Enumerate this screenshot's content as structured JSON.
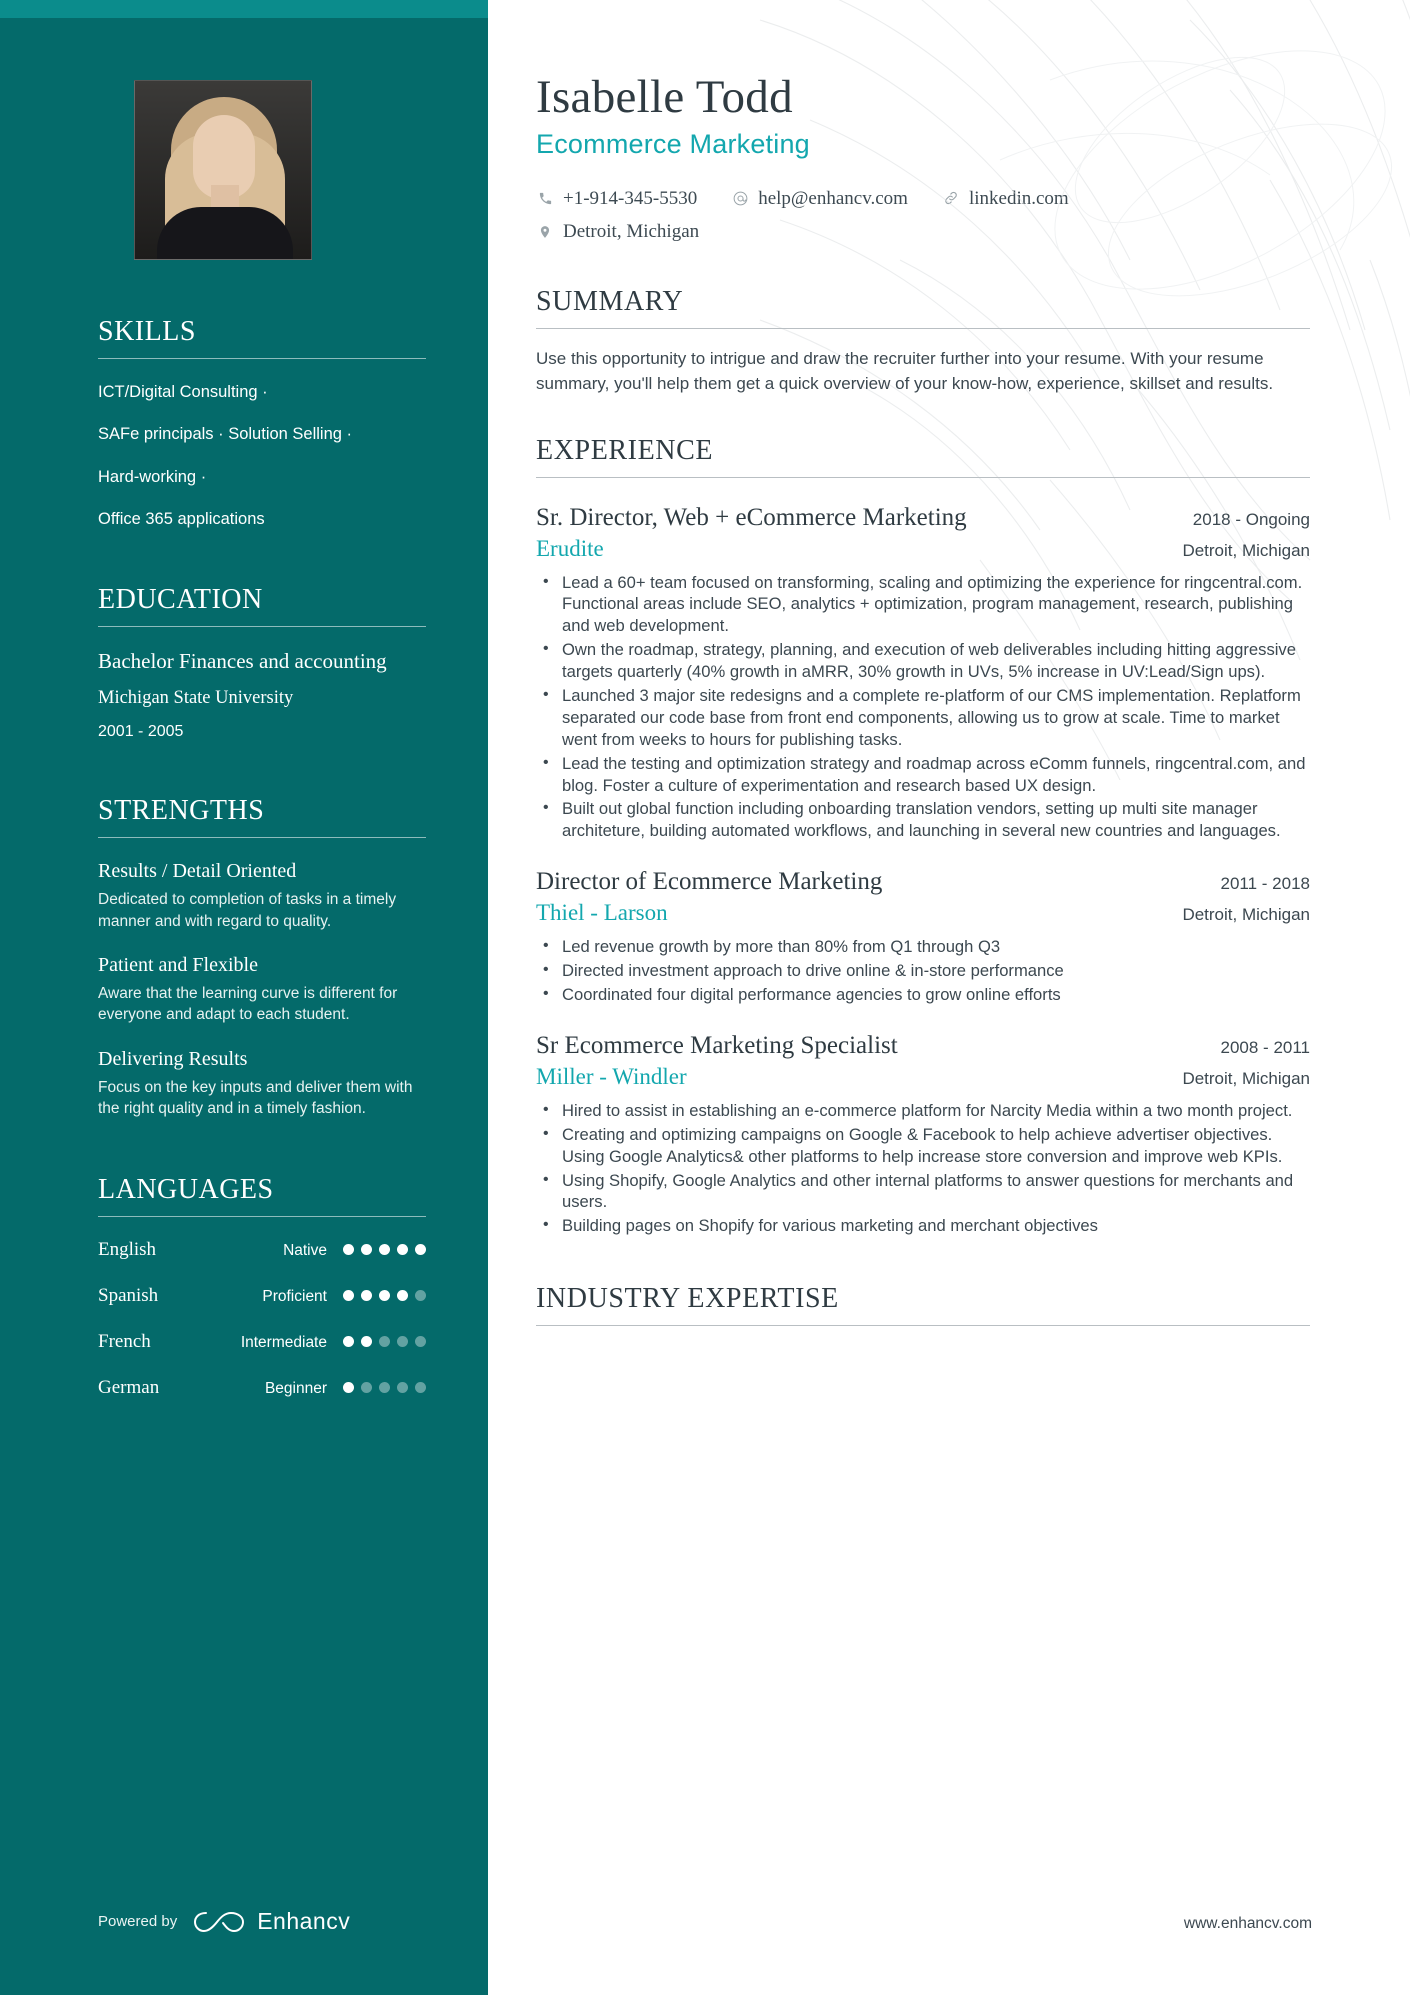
{
  "profile": {
    "name": "Isabelle Todd",
    "role": "Ecommerce Marketing",
    "photo_alt": "profile-photo"
  },
  "contacts": {
    "phone": "+1-914-345-5530",
    "email": "help@enhancv.com",
    "linkedin": "linkedin.com",
    "location": "Detroit, Michigan"
  },
  "sidebar": {
    "skills": {
      "title": "SKILLS",
      "items": [
        "ICT/Digital Consulting ·",
        "SAFe principals · Solution Selling ·",
        "Hard-working ·",
        "Office 365 applications"
      ]
    },
    "education": {
      "title": "EDUCATION",
      "degree": "Bachelor Finances and accounting",
      "school": "Michigan State University",
      "dates": "2001 - 2005"
    },
    "strengths": {
      "title": "STRENGTHS",
      "items": [
        {
          "name": "Results / Detail Oriented",
          "desc": "Dedicated to completion of tasks in a timely manner and with regard to quality."
        },
        {
          "name": "Patient and Flexible",
          "desc": "Aware that the learning curve is different for everyone and adapt to each student."
        },
        {
          "name": "Delivering Results",
          "desc": "Focus on the key inputs and deliver them with the right quality and in a timely fashion."
        }
      ]
    },
    "languages": {
      "title": "LANGUAGES",
      "items": [
        {
          "name": "English",
          "level": "Native",
          "rating": 5,
          "max": 5
        },
        {
          "name": "Spanish",
          "level": "Proficient",
          "rating": 4,
          "max": 5
        },
        {
          "name": "French",
          "level": "Intermediate",
          "rating": 2,
          "max": 5
        },
        {
          "name": "German",
          "level": "Beginner",
          "rating": 1,
          "max": 5
        }
      ]
    },
    "footer": {
      "powered_by": "Powered by",
      "brand": "Enhancv"
    }
  },
  "main": {
    "summary": {
      "title": "SUMMARY",
      "text": "Use this opportunity to intrigue and draw the recruiter further into your resume. With your resume summary, you'll help them get a quick overview of your know-how, experience, skillset and results."
    },
    "experience": {
      "title": "EXPERIENCE",
      "jobs": [
        {
          "title": "Sr. Director, Web + eCommerce Marketing",
          "dates": "2018 - Ongoing",
          "company": "Erudite",
          "location": "Detroit, Michigan",
          "bullets": [
            "Lead a 60+ team focused on transforming, scaling and optimizing the experience for ringcentral.com. Functional areas include SEO, analytics + optimization, program management, research, publishing and web development.",
            "Own the roadmap, strategy, planning, and execution of web deliverables including hitting aggressive targets quarterly (40% growth in aMRR, 30% growth in UVs, 5% increase in UV:Lead/Sign ups).",
            "Launched 3 major site redesigns and a complete re-platform of our CMS implementation. Replatform separated our code base from front end components, allowing us to grow at scale. Time to market went from weeks to hours for publishing tasks.",
            "Lead the testing and optimization strategy and roadmap across eComm funnels, ringcentral.com, and blog. Foster a culture of experimentation and research based UX design.",
            "Built out global function including onboarding translation vendors, setting up multi site manager architeture, building automated workflows, and launching in several new countries and languages."
          ]
        },
        {
          "title": "Director of Ecommerce Marketing",
          "dates": "2011 - 2018",
          "company": "Thiel - Larson",
          "location": "Detroit, Michigan",
          "bullets": [
            "Led revenue growth by more than 80% from Q1 through Q3",
            "Directed investment approach to drive online & in-store performance",
            "Coordinated four digital performance agencies to grow online efforts"
          ]
        },
        {
          "title": "Sr Ecommerce Marketing Specialist",
          "dates": "2008 - 2011",
          "company": "Miller - Windler",
          "location": "Detroit, Michigan",
          "bullets": [
            "Hired to assist in establishing an e-commerce platform for Narcity Media within a two month project.",
            " Creating and optimizing campaigns on Google & Facebook to help achieve advertiser objectives. Using Google Analytics& other platforms to help increase store conversion and improve web KPIs.",
            " Using Shopify, Google Analytics and other internal platforms to answer questions for merchants and users.",
            "Building pages on Shopify for various marketing and merchant objectives"
          ]
        }
      ]
    },
    "industry_expertise": {
      "title": "INDUSTRY EXPERTISE"
    },
    "site_url": "www.enhancv.com"
  },
  "colors": {
    "sidebar_bg": "#046a6a",
    "sidebar_accent": "#0b8c8c",
    "teal_text": "#13a7ae",
    "heading": "#2f3b42",
    "body_text": "#3c4850"
  }
}
